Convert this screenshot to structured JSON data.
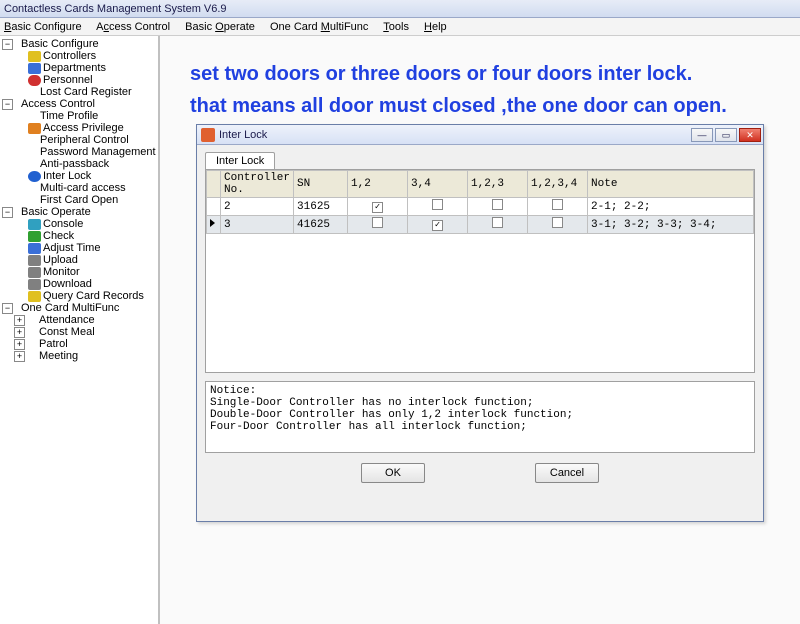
{
  "title": "Contactless Cards Management System  V6.9",
  "menu": [
    "Basic Configure",
    "Access Control",
    "Basic Operate",
    "One Card MultiFunc",
    "Tools",
    "Help"
  ],
  "menu_accel": [
    "B",
    "c",
    "O",
    "M",
    "T",
    "H"
  ],
  "tree": {
    "basic_configure": "Basic Configure",
    "controllers": "Controllers",
    "departments": "Departments",
    "personnel": "Personnel",
    "lost_card_register": "Lost Card Register",
    "access_control": "Access Control",
    "time_profile": "Time Profile",
    "access_privilege": "Access Privilege",
    "peripheral_control": "Peripheral Control",
    "password_management": "Password Management",
    "anti_passback": "Anti-passback",
    "inter_lock": "Inter Lock",
    "multi_card_access": "Multi-card access",
    "first_card_open": "First Card Open",
    "basic_operate": "Basic Operate",
    "console": "Console",
    "check": "Check",
    "adjust_time": "Adjust Time",
    "upload": "Upload",
    "monitor": "Monitor",
    "download": "Download",
    "query_card_records": "Query Card Records",
    "one_card_multifunc": "One Card MultiFunc",
    "attendance": "Attendance",
    "const_meal": "Const Meal",
    "patrol": "Patrol",
    "meeting": "Meeting"
  },
  "annotation": {
    "line1": "set two doors or three doors or four doors inter lock.",
    "line2": "that means all door must closed ,the one door can open."
  },
  "dialog": {
    "title": "Inter Lock",
    "tab": "Inter Lock",
    "headers": {
      "rowhead": "",
      "controller": "Controller No.",
      "sn": "SN",
      "c12": "1,2",
      "c34": "3,4",
      "c123": "1,2,3",
      "c1234": "1,2,3,4",
      "note": "Note"
    },
    "rows": [
      {
        "no": "2",
        "sn": "31625",
        "c12": true,
        "c34": false,
        "c123": false,
        "c1234": false,
        "note": "2-1;  2-2;"
      },
      {
        "no": "3",
        "sn": "41625",
        "c12": false,
        "c34": true,
        "c123": false,
        "c1234": false,
        "note": "3-1;  3-2;  3-3;  3-4;"
      }
    ],
    "notice": {
      "heading": "Notice:",
      "l1": "Single-Door Controller has no interlock function;",
      "l2": "Double-Door Controller has only 1,2 interlock function;",
      "l3": "Four-Door Controller has all interlock function;"
    },
    "buttons": {
      "ok": "OK",
      "cancel": "Cancel"
    }
  }
}
